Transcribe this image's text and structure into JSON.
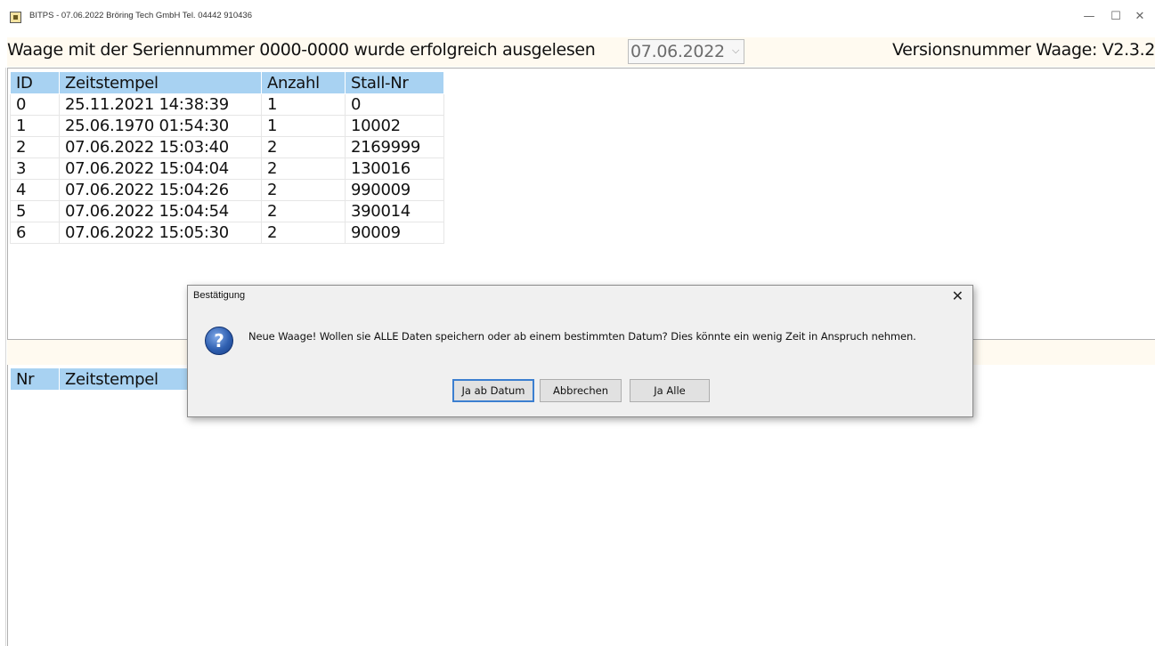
{
  "window": {
    "title": "BITPS - 07.06.2022 Bröring Tech GmbH  Tel. 04442 910436",
    "minimize": "—",
    "maximize": "☐",
    "close": "✕"
  },
  "header": {
    "message": "Waage mit der Seriennummer 0000-0000 wurde erfolgreich ausgelesen",
    "date_selected": "07.06.2022",
    "version": "Versionsnummer Waage: V2.3.2"
  },
  "top_table": {
    "columns": [
      "ID",
      "Zeitstempel",
      "Anzahl",
      "Stall-Nr"
    ],
    "rows": [
      [
        "0",
        "25.11.2021 14:38:39",
        "1",
        "0"
      ],
      [
        "1",
        "25.06.1970 01:54:30",
        "1",
        "10002"
      ],
      [
        "2",
        "07.06.2022 15:03:40",
        "2",
        "2169999"
      ],
      [
        "3",
        "07.06.2022 15:04:04",
        "2",
        "130016"
      ],
      [
        "4",
        "07.06.2022 15:04:26",
        "2",
        "990009"
      ],
      [
        "5",
        "07.06.2022 15:04:54",
        "2",
        "390014"
      ],
      [
        "6",
        "07.06.2022 15:05:30",
        "2",
        "90009"
      ]
    ]
  },
  "bottom_table": {
    "columns": [
      "Nr",
      "Zeitstempel"
    ]
  },
  "dialog": {
    "title": "Bestätigung",
    "close": "✕",
    "icon": "question-icon",
    "message": "Neue Waage! Wollen sie ALLE Daten speichern oder ab einem bestimmten Datum? Dies könnte ein wenig Zeit in Anspruch nehmen.",
    "buttons": {
      "from_date": "Ja ab Datum",
      "cancel": "Abbrechen",
      "all": "Ja Alle"
    }
  }
}
